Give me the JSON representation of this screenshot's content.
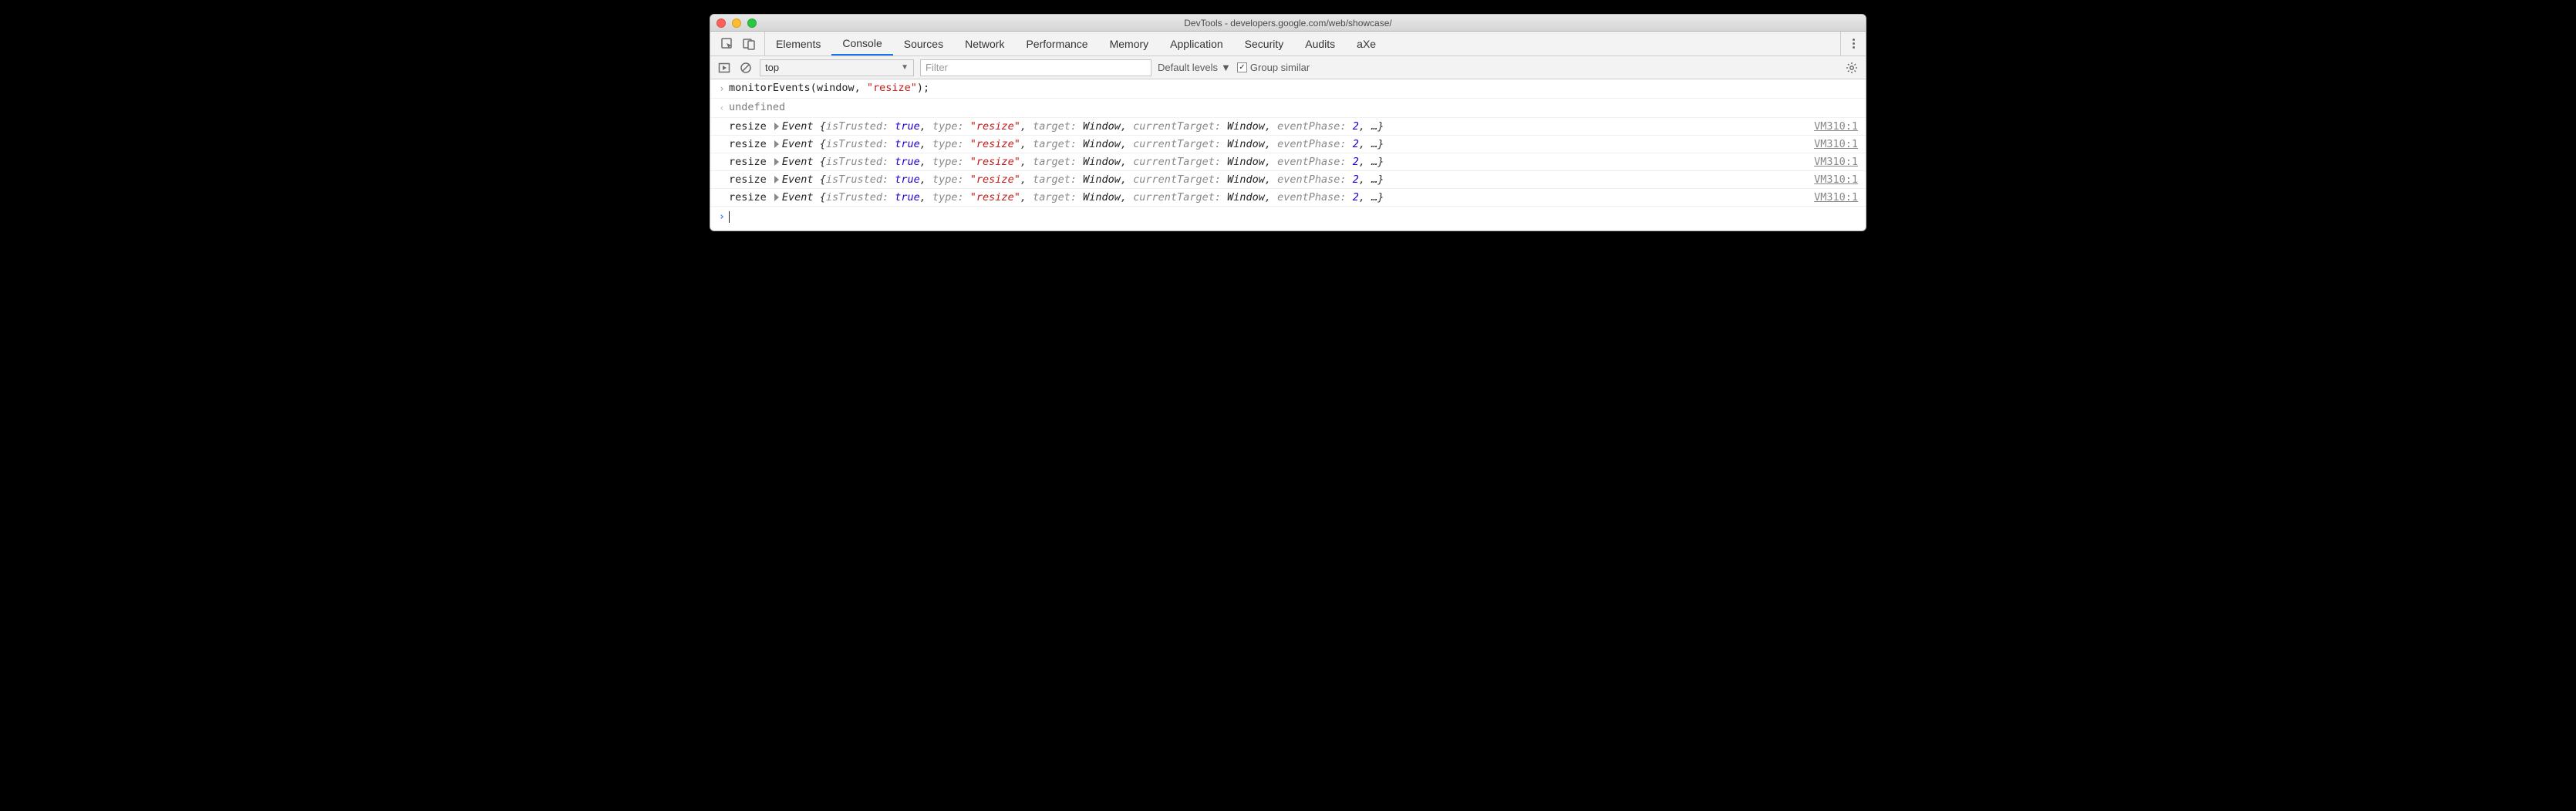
{
  "window": {
    "title": "DevTools - developers.google.com/web/showcase/"
  },
  "tabs": {
    "items": [
      "Elements",
      "Console",
      "Sources",
      "Network",
      "Performance",
      "Memory",
      "Application",
      "Security",
      "Audits",
      "aXe"
    ],
    "activeIndex": 1
  },
  "toolbar": {
    "context": "top",
    "filter_placeholder": "Filter",
    "levels_label": "Default levels",
    "group_label": "Group similar",
    "group_checked": true
  },
  "console": {
    "input_line": {
      "fn": "monitorEvents",
      "arg0": "window",
      "arg1": "\"resize\"",
      "tail": ");"
    },
    "return_line": "undefined",
    "events": [
      {
        "label": "resize",
        "class": "Event",
        "k1": "isTrusted",
        "v1": "true",
        "k2": "type",
        "v2": "\"resize\"",
        "k3": "target",
        "v3": "Window",
        "k4": "currentTarget",
        "v4": "Window",
        "k5": "eventPhase",
        "v5": "2",
        "ell": "…",
        "source": "VM310:1"
      },
      {
        "label": "resize",
        "class": "Event",
        "k1": "isTrusted",
        "v1": "true",
        "k2": "type",
        "v2": "\"resize\"",
        "k3": "target",
        "v3": "Window",
        "k4": "currentTarget",
        "v4": "Window",
        "k5": "eventPhase",
        "v5": "2",
        "ell": "…",
        "source": "VM310:1"
      },
      {
        "label": "resize",
        "class": "Event",
        "k1": "isTrusted",
        "v1": "true",
        "k2": "type",
        "v2": "\"resize\"",
        "k3": "target",
        "v3": "Window",
        "k4": "currentTarget",
        "v4": "Window",
        "k5": "eventPhase",
        "v5": "2",
        "ell": "…",
        "source": "VM310:1"
      },
      {
        "label": "resize",
        "class": "Event",
        "k1": "isTrusted",
        "v1": "true",
        "k2": "type",
        "v2": "\"resize\"",
        "k3": "target",
        "v3": "Window",
        "k4": "currentTarget",
        "v4": "Window",
        "k5": "eventPhase",
        "v5": "2",
        "ell": "…",
        "source": "VM310:1"
      },
      {
        "label": "resize",
        "class": "Event",
        "k1": "isTrusted",
        "v1": "true",
        "k2": "type",
        "v2": "\"resize\"",
        "k3": "target",
        "v3": "Window",
        "k4": "currentTarget",
        "v4": "Window",
        "k5": "eventPhase",
        "v5": "2",
        "ell": "…",
        "source": "VM310:1"
      }
    ]
  }
}
